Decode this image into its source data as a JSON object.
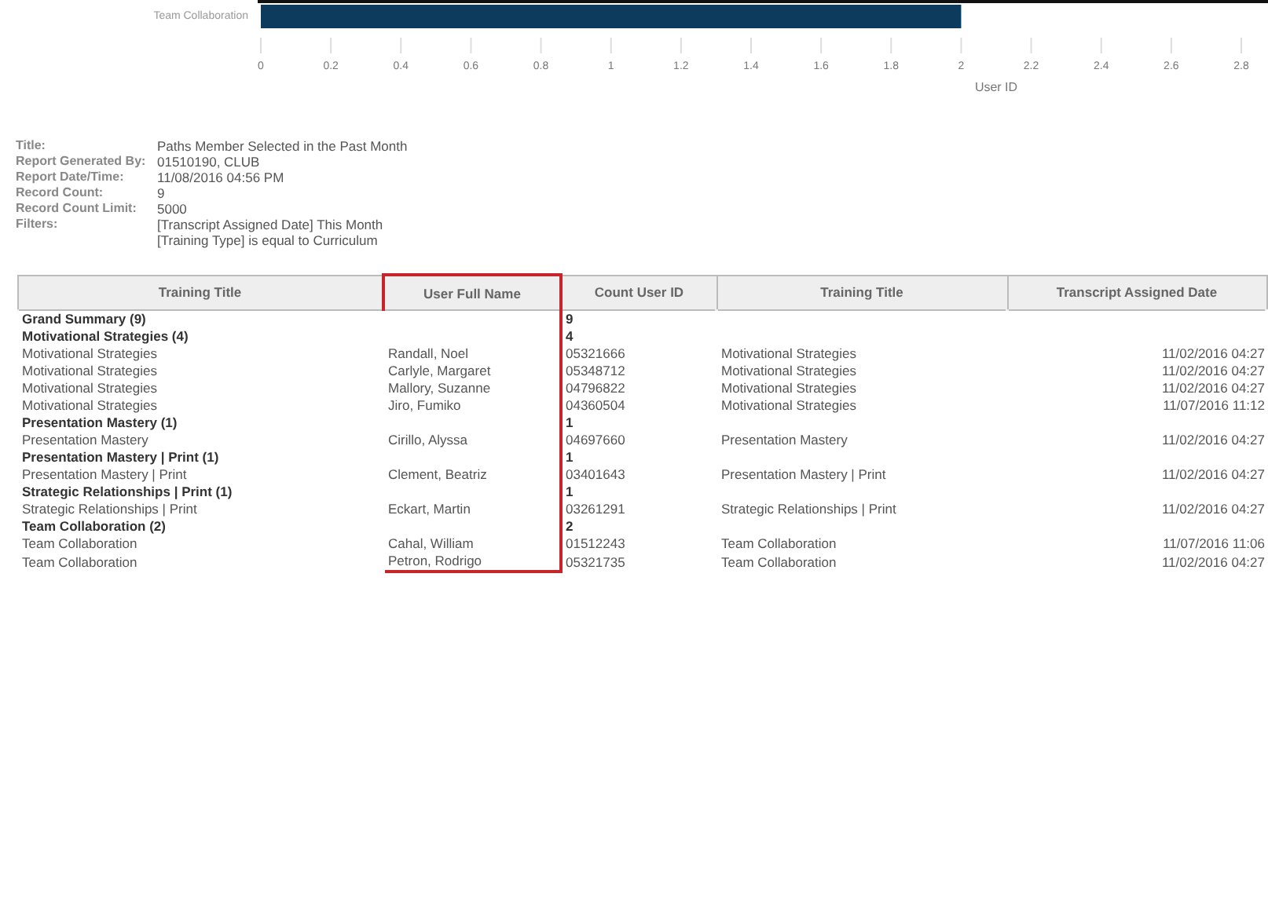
{
  "chart": {
    "chart_data": {
      "type": "bar",
      "orientation": "horizontal",
      "categories": [
        "Team Collaboration"
      ],
      "series": [
        {
          "color": "#0d3b5e",
          "values": [
            2
          ]
        }
      ],
      "xlabel": "User ID",
      "xlim": [
        0,
        2.8
      ],
      "xticks": [
        0,
        {
          "value": 0.2,
          "label": "0.2"
        },
        {
          "value": 0.4,
          "label": "0.4"
        },
        {
          "value": 0.6,
          "label": "0.6"
        },
        {
          "value": 0.8,
          "label": "0.8"
        },
        1,
        {
          "value": 1.2,
          "label": "1.2"
        },
        {
          "value": 1.4,
          "label": "1.4"
        },
        {
          "value": 1.6,
          "label": "1.6"
        },
        {
          "value": 1.8,
          "label": "1.8"
        },
        2,
        {
          "value": 2.2,
          "label": "2.2"
        },
        {
          "value": 2.4,
          "label": "2.4"
        },
        {
          "value": 2.6,
          "label": "2.6"
        },
        {
          "value": 2.8,
          "label": "2.8"
        }
      ]
    }
  },
  "report_info": [
    {
      "label": "Title:",
      "values": [
        "Paths Member Selected in the Past Month"
      ]
    },
    {
      "label": "Report Generated By:",
      "values": [
        "01510190, CLUB"
      ]
    },
    {
      "label": "Report Date/Time:",
      "values": [
        "11/08/2016 04:56 PM"
      ]
    },
    {
      "label": "Record Count:",
      "values": [
        "9"
      ]
    },
    {
      "label": "Record Count Limit:",
      "values": [
        "5000"
      ]
    },
    {
      "label": "Filters:",
      "values": [
        "[Transcript Assigned Date] This Month",
        "[Training Type] is equal to Curriculum"
      ]
    }
  ],
  "table": {
    "columns": [
      {
        "label": "Training Title",
        "highlighted": false
      },
      {
        "label": "User Full Name",
        "highlighted": true
      },
      {
        "label": "Count User ID",
        "highlighted": false
      },
      {
        "label": "Training Title",
        "highlighted": false
      },
      {
        "label": "Transcript Assigned Date",
        "highlighted": false
      }
    ],
    "rows": [
      {
        "kind": "group",
        "title": "Grand Summary (9)",
        "count": "9"
      },
      {
        "kind": "group",
        "title": "Motivational Strategies (4)",
        "count": "4"
      },
      {
        "kind": "detail",
        "cells": [
          "Motivational Strategies",
          "Randall, Noel",
          "05321666",
          "Motivational Strategies",
          "11/02/2016 04:27"
        ]
      },
      {
        "kind": "detail",
        "cells": [
          "Motivational Strategies",
          "Carlyle, Margaret",
          "05348712",
          "Motivational Strategies",
          "11/02/2016 04:27"
        ]
      },
      {
        "kind": "detail",
        "cells": [
          "Motivational Strategies",
          "Mallory, Suzanne",
          "04796822",
          "Motivational Strategies",
          "11/02/2016 04:27"
        ]
      },
      {
        "kind": "detail",
        "cells": [
          "Motivational Strategies",
          "Jiro, Fumiko",
          "04360504",
          "Motivational Strategies",
          "11/07/2016 11:12"
        ]
      },
      {
        "kind": "group",
        "title": "Presentation Mastery (1)",
        "count": "1"
      },
      {
        "kind": "detail",
        "cells": [
          "Presentation Mastery",
          "Cirillo, Alyssa",
          "04697660",
          "Presentation Mastery",
          "11/02/2016 04:27"
        ]
      },
      {
        "kind": "group",
        "title": "Presentation Mastery | Print (1)",
        "count": "1"
      },
      {
        "kind": "detail",
        "cells": [
          "Presentation Mastery | Print",
          "Clement, Beatriz",
          "03401643",
          "Presentation Mastery | Print",
          "11/02/2016 04:27"
        ]
      },
      {
        "kind": "group",
        "title": "Strategic Relationships | Print (1)",
        "count": "1"
      },
      {
        "kind": "detail",
        "cells": [
          "Strategic Relationships | Print",
          "Eckart, Martin",
          "03261291",
          "Strategic Relationships | Print",
          "11/02/2016 04:27"
        ]
      },
      {
        "kind": "group",
        "title": "Team Collaboration (2)",
        "count": "2"
      },
      {
        "kind": "detail",
        "cells": [
          "Team Collaboration",
          "Cahal, William",
          "01512243",
          "Team Collaboration",
          "11/07/2016 11:06"
        ]
      },
      {
        "kind": "detail",
        "cells": [
          "Team Collaboration",
          "Petron, Rodrigo",
          "05321735",
          "Team Collaboration",
          "11/02/2016 04:27"
        ]
      }
    ]
  }
}
